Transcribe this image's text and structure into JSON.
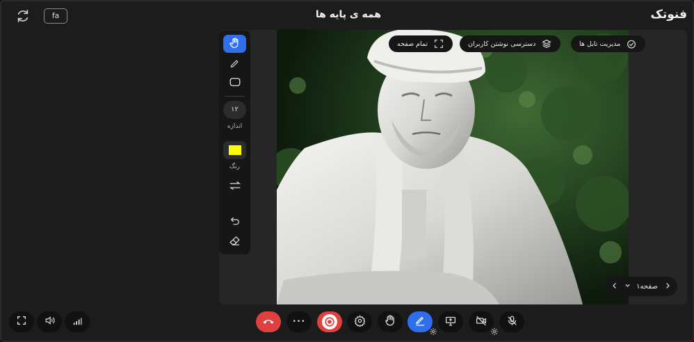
{
  "header": {
    "brand": "فنوتک",
    "title": "همه ی پایه ها",
    "lang_button": "fa"
  },
  "stage": {
    "fullscreen_label": "تمام صفحه",
    "user_writing_access_label": "دسترسی نوشتن کاربران",
    "board_management_label": "مدیریت تابل ها",
    "image_alt": "Statue photo"
  },
  "toolbar": {
    "size_value": "۱۲",
    "size_label": "اندازه",
    "color_label": "رنگ",
    "color_value": "#ffff00"
  },
  "pager": {
    "page_label": "صفحه۱"
  },
  "bottom": {
    "more_label": "•••"
  },
  "colors": {
    "accent": "#2f6fec",
    "danger": "#e0413f",
    "background": "#1c1c1c"
  },
  "icons": [
    "refresh-icon",
    "hand-pointer-icon",
    "pen-icon",
    "rectangle-icon",
    "swap-icon",
    "undo-icon",
    "eraser-icon",
    "fullscreen-icon",
    "layers-icon",
    "board-icon",
    "chevron-left-icon",
    "chevron-right-icon",
    "chevron-down-icon",
    "expand-icon",
    "speaker-icon",
    "signal-icon",
    "hang-up-icon",
    "record-icon",
    "settings-icon",
    "raise-hand-icon",
    "screen-share-icon",
    "camera-off-icon",
    "mic-off-icon"
  ]
}
